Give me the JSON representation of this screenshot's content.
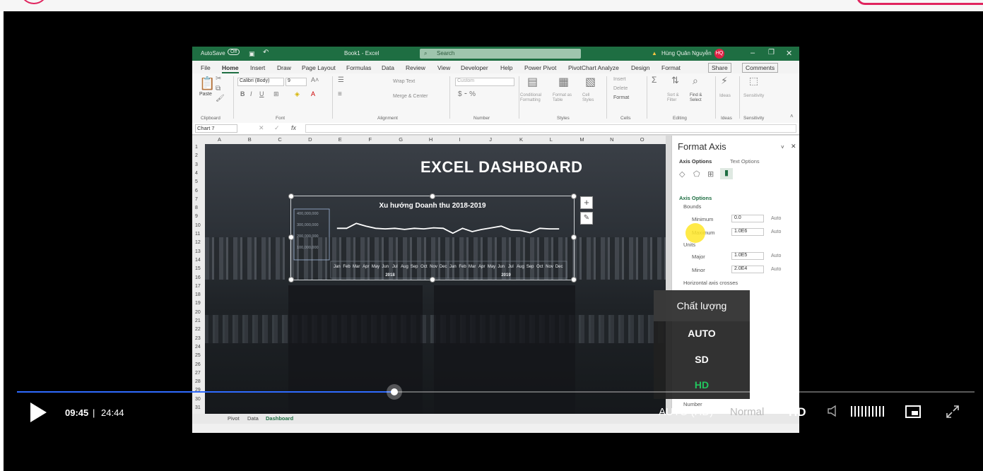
{
  "excel": {
    "title_bar": {
      "autosave": "AutoSave",
      "autosave_state": "Off",
      "book": "Book1 - Excel",
      "search": "Search",
      "user": "Hùng Quân Nguyễn",
      "user_initials": "HQ"
    },
    "tabs": [
      "File",
      "Home",
      "Insert",
      "Draw",
      "Page Layout",
      "Formulas",
      "Data",
      "Review",
      "View",
      "Developer",
      "Help",
      "Power Pivot",
      "PivotChart Analyze",
      "Design",
      "Format"
    ],
    "share": "Share",
    "comments": "Comments",
    "ribbon": {
      "paste": "Paste",
      "font_name": "Calibri (Body)",
      "font_size": "9",
      "wrap_text": "Wrap Text",
      "merge_center": "Merge & Center",
      "number_format": "Custom",
      "conditional_formatting": "Conditional Formatting",
      "format_as_table": "Format as Table",
      "cell_styles": "Cell Styles",
      "insert": "Insert",
      "delete": "Delete",
      "format": "Format",
      "sort_filter": "Sort & Filter",
      "find_select": "Find & Select",
      "ideas": "Ideas",
      "sensitivity": "Sensitivity",
      "groups": [
        "Clipboard",
        "Font",
        "Alignment",
        "Number",
        "Styles",
        "Cells",
        "Editing",
        "Ideas",
        "Sensitivity"
      ]
    },
    "name_box": "Chart 7",
    "fx": "fx",
    "columns": [
      "A",
      "B",
      "C",
      "D",
      "E",
      "F",
      "G",
      "H",
      "I",
      "J",
      "K",
      "L",
      "M",
      "N",
      "O"
    ],
    "rows": [
      "1",
      "2",
      "3",
      "4",
      "5",
      "6",
      "7",
      "8",
      "9",
      "10",
      "11",
      "12",
      "13",
      "14",
      "15",
      "16",
      "17",
      "18",
      "19",
      "20",
      "21",
      "22",
      "23",
      "24",
      "25",
      "26",
      "27",
      "28",
      "29",
      "30",
      "31"
    ],
    "dashboard_title": "EXCEL DASHBOARD",
    "sheet_tabs": [
      "Pivot",
      "Data",
      "Dashboard"
    ],
    "format_pane": {
      "title": "Format Axis",
      "tab_axis": "Axis Options",
      "tab_text": "Text Options",
      "section": "Axis Options",
      "bounds": "Bounds",
      "minimum_label": "Minimum",
      "minimum_value": "0.0",
      "maximum_label": "Maximum",
      "maximum_value": "1.0E6",
      "units": "Units",
      "major_label": "Major",
      "major_value": "1.0E5",
      "minor_label": "Minor",
      "minor_value": "2.0E4",
      "auto": "Auto",
      "horizontal_axis_crosses": "Horizontal axis crosses",
      "number": "Number"
    }
  },
  "chart_data": {
    "type": "line",
    "title": "Xu hướng Doanh thu 2018-2019",
    "categories": [
      "Jan",
      "Feb",
      "Mar",
      "Apr",
      "May",
      "Jun",
      "Jul",
      "Aug",
      "Sep",
      "Oct",
      "Nov",
      "Dec",
      "Jan",
      "Feb",
      "Mar",
      "Apr",
      "May",
      "Jun",
      "Jul",
      "Aug",
      "Sep",
      "Oct",
      "Nov",
      "Dec"
    ],
    "category_groups": [
      {
        "label": "2018",
        "span": 12
      },
      {
        "label": "2019",
        "span": 12
      }
    ],
    "y_tick_labels": [
      "400,000,000",
      "300,000,000",
      "200,000,000",
      "100,000,000"
    ],
    "values": [
      300,
      300,
      345,
      320,
      300,
      295,
      300,
      290,
      300,
      295,
      305,
      300,
      255,
      300,
      270,
      290,
      305,
      320,
      285,
      280,
      260,
      300,
      295,
      295
    ],
    "ylim": [
      0,
      450
    ],
    "line_color": "#ffffff"
  },
  "quality_menu": {
    "header": "Chất lượng",
    "options": [
      "AUTO",
      "SD",
      "HD"
    ],
    "selected": "HD",
    "selected_color": "#22c55e"
  },
  "controls": {
    "current_time": "09:45",
    "separator": "|",
    "duration": "24:44",
    "progress": 0.394,
    "quality_label": "AUTO (HD)",
    "speed_label": "Normal",
    "hd_label": "HD",
    "progress_color": "#2f6bff"
  }
}
